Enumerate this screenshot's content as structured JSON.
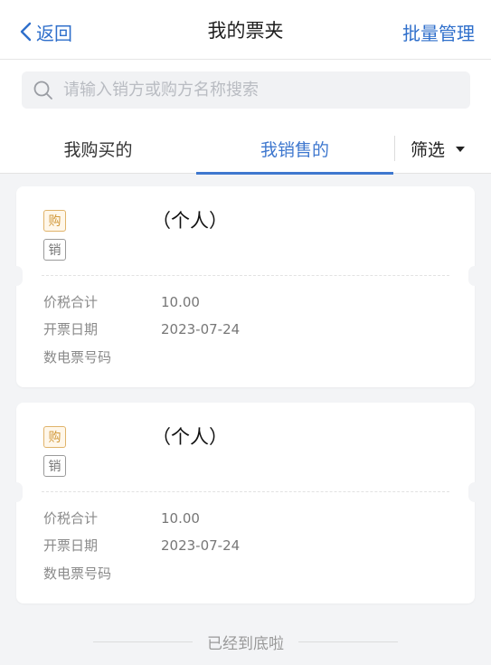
{
  "nav": {
    "back_label": "返回",
    "title": "我的票夹",
    "batch_label": "批量管理"
  },
  "search": {
    "placeholder": "请输入销方或购方名称搜索",
    "value": ""
  },
  "tabs": [
    {
      "label": "我购买的",
      "active": false
    },
    {
      "label": "我销售的",
      "active": true
    }
  ],
  "filter": {
    "label": "筛选"
  },
  "colors": {
    "accent": "#3f78cf",
    "buy_badge": "#d29a3c",
    "sell_badge": "#777777"
  },
  "invoices": [
    {
      "buy_badge": "购",
      "sell_badge": "销",
      "name": "（个人）",
      "fields": [
        {
          "label": "价税合计",
          "value": "10.00"
        },
        {
          "label": "开票日期",
          "value": "2023-07-24"
        },
        {
          "label": "数电票号码",
          "value": ""
        }
      ]
    },
    {
      "buy_badge": "购",
      "sell_badge": "销",
      "name": "（个人）",
      "fields": [
        {
          "label": "价税合计",
          "value": "10.00"
        },
        {
          "label": "开票日期",
          "value": "2023-07-24"
        },
        {
          "label": "数电票号码",
          "value": ""
        }
      ]
    }
  ],
  "footer": {
    "end_text": "已经到底啦"
  }
}
